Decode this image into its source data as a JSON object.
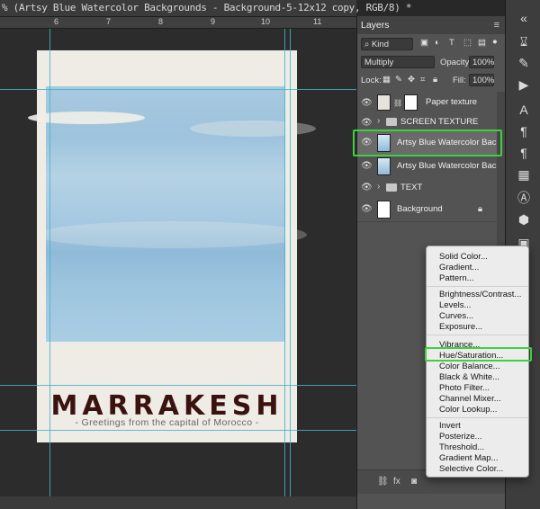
{
  "document": {
    "title": "% (Artsy Blue Watercolor Backgrounds - Background-5-12x12 copy, RGB/8) *",
    "ruler_labels": [
      "6",
      "7",
      "8",
      "9",
      "10",
      "11"
    ]
  },
  "poster": {
    "title": "MARRAKESH",
    "subtitle": "- Greetings from the capital of Morocco -"
  },
  "layers_panel": {
    "tab_label": "Layers",
    "menu_icon": "≡",
    "filter_kind": "Kind",
    "blend_mode": "Multiply",
    "opacity_label": "Opacity:",
    "opacity_value": "100%",
    "lock_label": "Lock:",
    "fill_label": "Fill:",
    "fill_value": "100%",
    "layers": [
      {
        "name": "Paper texture",
        "type": "pixel",
        "selected": false
      },
      {
        "name": "SCREEN TEXTURE",
        "type": "group",
        "selected": false
      },
      {
        "name": "Artsy Blue Watercolor Back...",
        "type": "smart",
        "selected": true
      },
      {
        "name": "Artsy Blue Watercolor Back...",
        "type": "smart",
        "selected": false
      },
      {
        "name": "TEXT",
        "type": "group",
        "selected": false
      },
      {
        "name": "Background",
        "type": "pixel",
        "selected": false
      }
    ],
    "footer_fx": "fx"
  },
  "adjustment_menu": {
    "group1": [
      "Solid Color...",
      "Gradient...",
      "Pattern..."
    ],
    "group2": [
      "Brightness/Contrast...",
      "Levels...",
      "Curves...",
      "Exposure..."
    ],
    "group3": [
      "Vibrance...",
      "Hue/Saturation...",
      "Color Balance...",
      "Black & White...",
      "Photo Filter...",
      "Channel Mixer...",
      "Color Lookup..."
    ],
    "group4": [
      "Invert",
      "Posterize...",
      "Threshold...",
      "Gradient Map...",
      "Selective Color..."
    ],
    "highlighted": "Hue/Saturation..."
  },
  "colors": {
    "accent_highlight": "#3ed13e",
    "guide": "#3fb5c9",
    "poster_title": "#3a1210"
  }
}
